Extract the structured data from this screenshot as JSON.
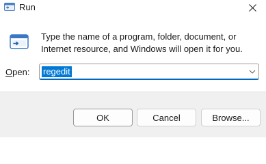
{
  "window": {
    "title": "Run"
  },
  "content": {
    "description": "Type the name of a program, folder, document, or Internet resource, and Windows will open it for you.",
    "open_label_prefix": "",
    "open_label_key": "O",
    "open_label_rest": "pen:",
    "input_value": "regedit"
  },
  "buttons": {
    "ok": "OK",
    "cancel": "Cancel",
    "browse_prefix": "Browse",
    "browse_suffix": "..."
  },
  "icons": {
    "title": "run-app-icon",
    "run": "run-app-icon",
    "close": "close-icon",
    "dropdown": "chevron-down-icon"
  },
  "colors": {
    "accent": "#0078d4",
    "input_underline": "#0067c0",
    "footer_bg": "#f0f0f0"
  }
}
